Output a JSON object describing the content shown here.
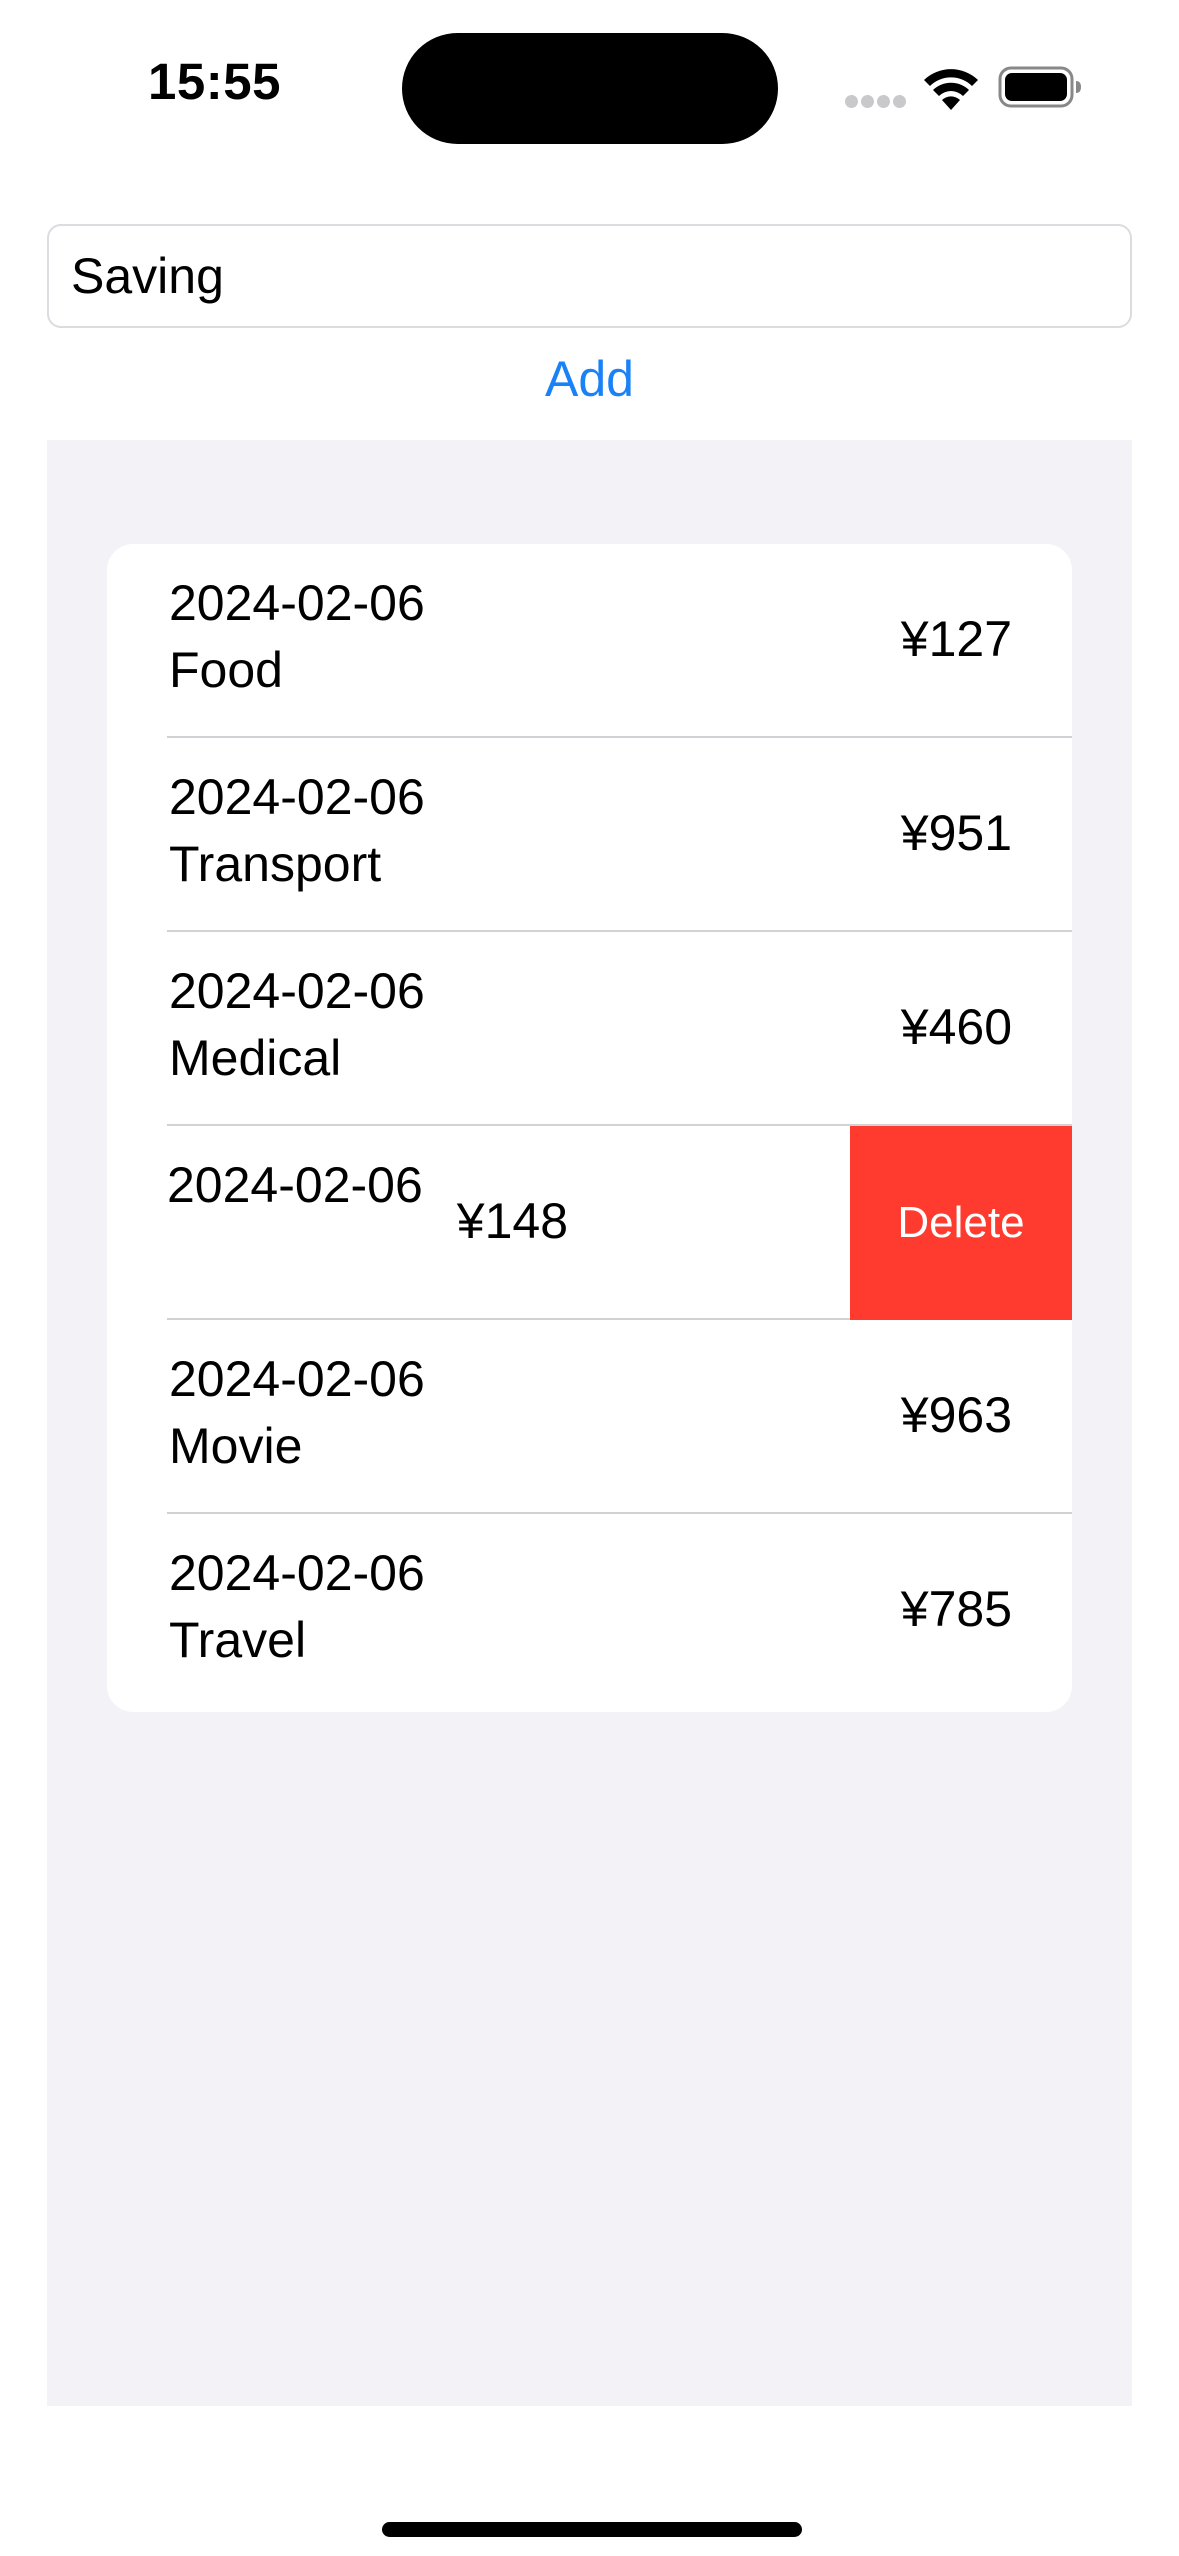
{
  "status_bar": {
    "time": "15:55"
  },
  "input": {
    "value": "Saving"
  },
  "add_label": "Add",
  "entries": [
    {
      "date": "2024-02-06",
      "category": "Food",
      "amount": "¥127"
    },
    {
      "date": "2024-02-06",
      "category": "Transport",
      "amount": "¥951"
    },
    {
      "date": "2024-02-06",
      "category": "Medical",
      "amount": "¥460"
    },
    {
      "date": "2024-02-06",
      "category": "",
      "amount": "¥148",
      "swiped": true
    },
    {
      "date": "2024-02-06",
      "category": "Movie",
      "amount": "¥963"
    },
    {
      "date": "2024-02-06",
      "category": "Travel",
      "amount": "¥785"
    }
  ],
  "delete_label": "Delete",
  "colors": {
    "accent": "#1a82f7",
    "destructive": "#ff3b30",
    "list_background": "#f2f2f7"
  }
}
